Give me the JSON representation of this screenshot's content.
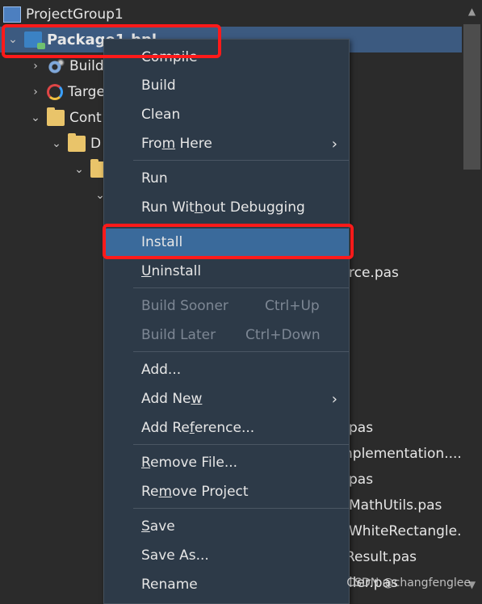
{
  "tree": {
    "project_group": "ProjectGroup1",
    "package": "Package1.bpl",
    "build_config": "Build",
    "target": "Targe",
    "contains": "Cont",
    "d": "D",
    "right_labels": [
      "rce.pas",
      "pas",
      "nplementation....",
      "pas",
      "MathUtils.pas",
      "WhiteRectangle...",
      "Result.pas",
      "ller.pas"
    ]
  },
  "menu": {
    "compile": "Compile",
    "build": "Build",
    "clean": "Clean",
    "from_here_pre": "Fro",
    "from_here_u": "m",
    "from_here_post": " Here",
    "run": "Run",
    "run_without_pre": "Run Wit",
    "run_without_u": "h",
    "run_without_post": "out Debugging",
    "install": "Install",
    "uninstall_u": "U",
    "uninstall_post": "ninstall",
    "build_sooner": "Build Sooner",
    "build_sooner_shortcut": "Ctrl+Up",
    "build_later": "Build Later",
    "build_later_shortcut": "Ctrl+Down",
    "add": "Add...",
    "add_new_pre": "Add Ne",
    "add_new_u": "w",
    "add_reference_pre": "Add Re",
    "add_reference_u": "f",
    "add_reference_post": "erence...",
    "remove_file_u": "R",
    "remove_file_post": "emove File...",
    "remove_project_pre": "Re",
    "remove_project_u": "m",
    "remove_project_post": "ove Project",
    "save_u": "S",
    "save_post": "ave",
    "save_as": "Save As...",
    "rename": "Rename"
  },
  "watermark": "CSDN @changfenglee",
  "colors": {
    "background": "#2b2b2b",
    "selection": "#3c5a80",
    "menu_bg": "#2d3a48",
    "menu_highlight": "#3a6a9b",
    "annotation_red": "#ff1a1a"
  }
}
